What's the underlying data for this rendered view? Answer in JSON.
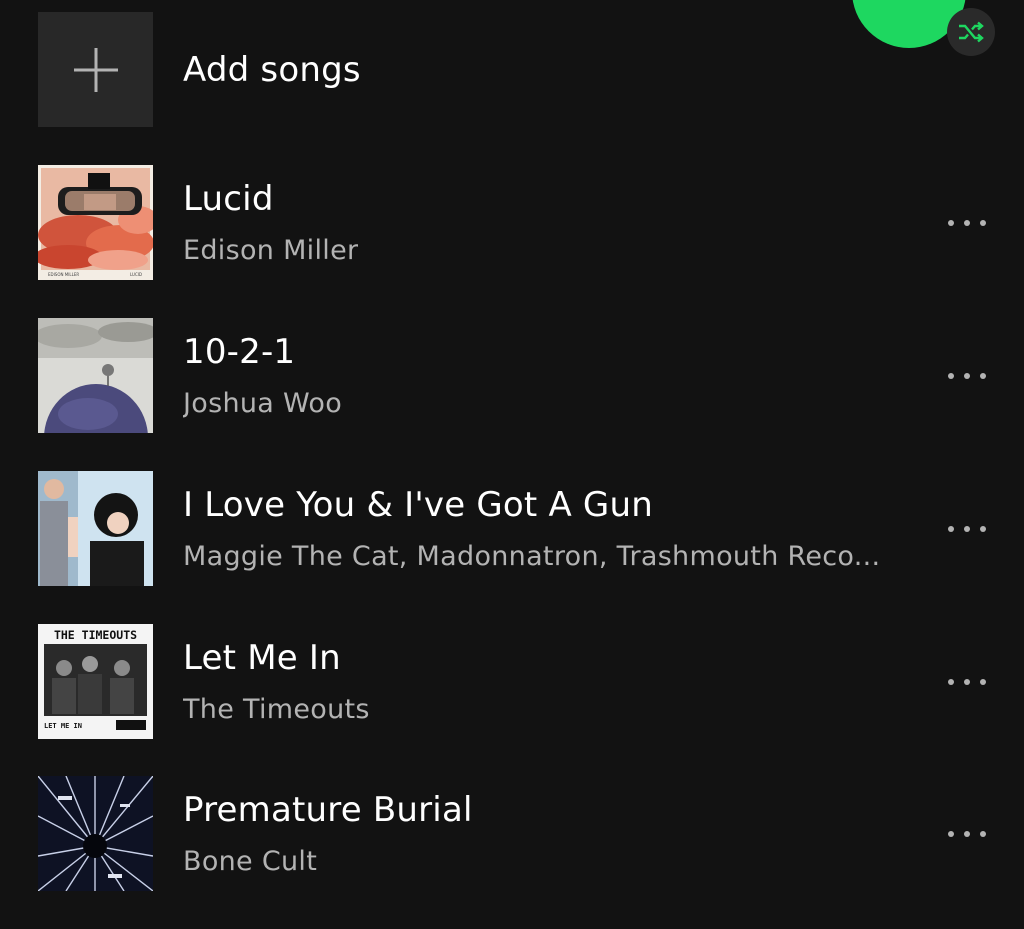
{
  "header": {
    "play_icon": "play-icon",
    "shuffle_icon": "shuffle-icon",
    "accent": "#1ed760"
  },
  "add_songs": {
    "label": "Add songs",
    "icon": "plus-icon"
  },
  "tracks": [
    {
      "title": "Lucid",
      "artist": "Edison Miller",
      "cover_text": [
        "EDISON MILLER",
        "LUCID"
      ]
    },
    {
      "title": "10-2-1",
      "artist": "Joshua Woo"
    },
    {
      "title": "I Love You & I've Got A Gun",
      "artist": "Maggie The Cat, Madonnatron, Trashmouth Reco..."
    },
    {
      "title": "Let Me In",
      "artist": "The Timeouts",
      "cover_text": [
        "THE TIMEOUTS",
        "LET ME IN"
      ]
    },
    {
      "title": "Premature Burial",
      "artist": "Bone Cult"
    }
  ],
  "more_icon": "more-options-icon",
  "colors": {
    "background": "#121212",
    "primary_text": "#ffffff",
    "secondary_text": "#b3b3b3"
  }
}
